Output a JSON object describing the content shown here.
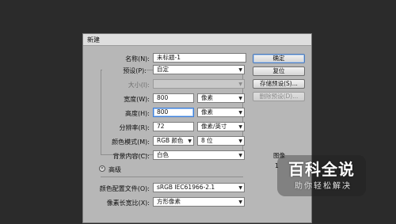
{
  "dialog": {
    "title": "新建",
    "labels": {
      "name": "名称(N):",
      "preset": "预设(P):",
      "size": "大小(I):",
      "width": "宽度(W):",
      "height": "高度(H):",
      "resolution": "分辨率(R):",
      "color_mode": "颜色模式(M):",
      "background": "背景内容(C):",
      "advanced": "高级",
      "color_profile": "颜色配置文件(O):",
      "pixel_aspect": "像素长宽比(X):"
    },
    "values": {
      "name": "未标题-1",
      "preset": "自定",
      "size": "",
      "width": "800",
      "width_unit": "像素",
      "height": "800",
      "height_unit": "像素",
      "resolution": "72",
      "resolution_unit": "像素/英寸",
      "color_mode": "RGB 颜色",
      "bit_depth": "8 位",
      "background": "白色",
      "color_profile": "sRGB IEC61966-2.1",
      "pixel_aspect": "方形像素"
    },
    "buttons": {
      "ok": "确定",
      "reset": "复位",
      "save_preset": "存储预设(S)...",
      "delete_preset": "删除预设(D)..."
    },
    "info": {
      "image_size_label": "图像",
      "image_size_value": "1"
    }
  },
  "watermark": {
    "title": "百科全说",
    "subtitle": "助你轻松解决"
  }
}
